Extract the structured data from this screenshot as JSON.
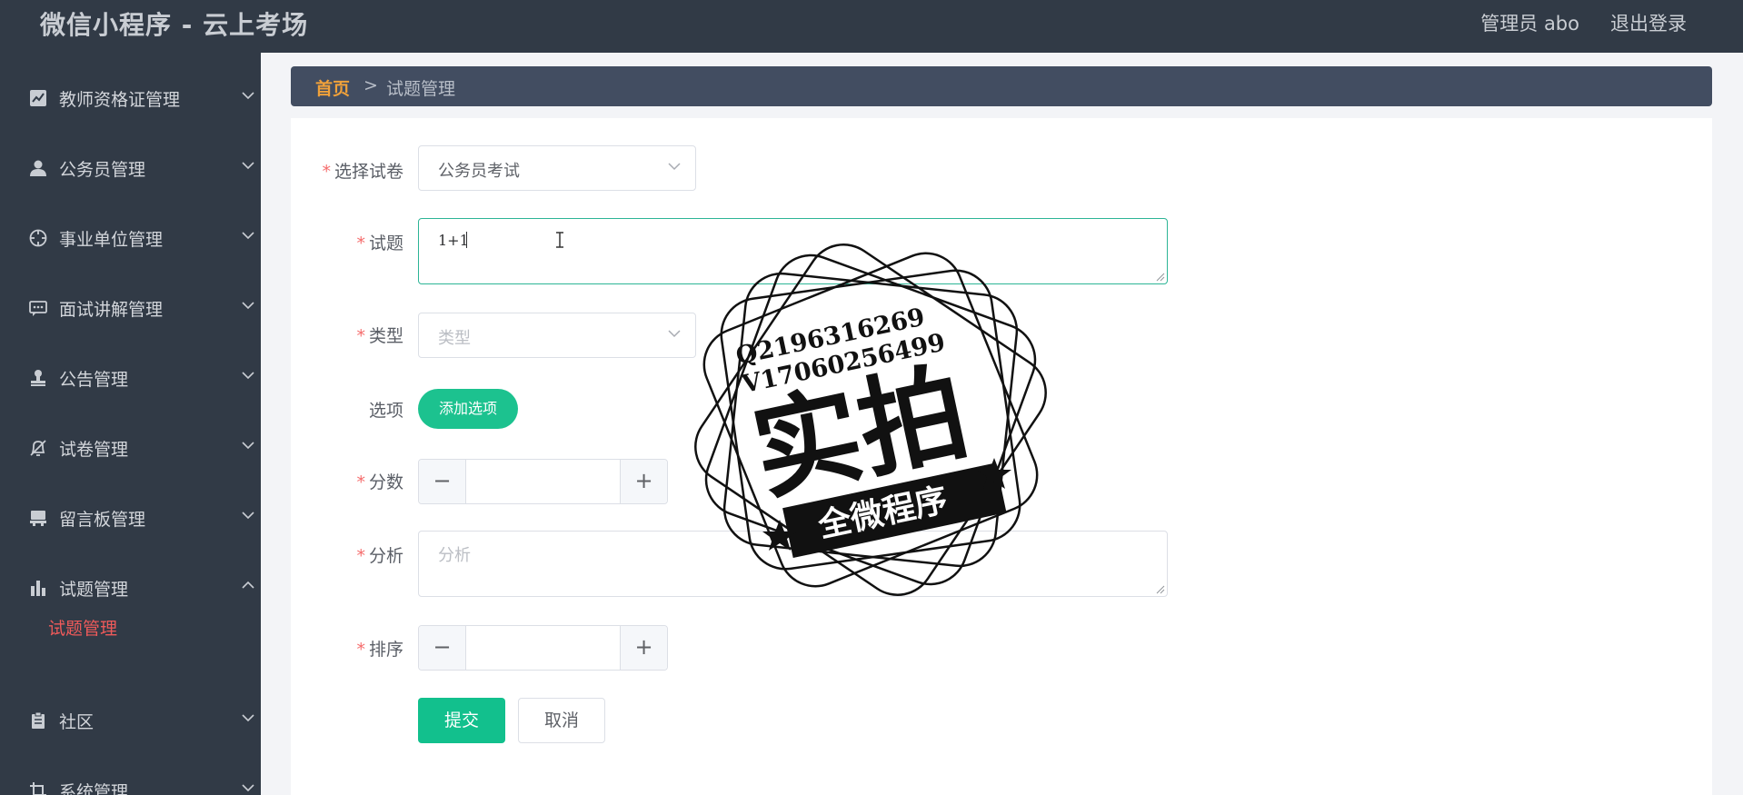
{
  "app": {
    "title": "微信小程序 - 云上考场"
  },
  "header": {
    "user_label": "管理员 abo",
    "logout_label": "退出登录"
  },
  "sidebar": {
    "items": [
      {
        "label": "教师资格证管理",
        "icon": "chart-icon"
      },
      {
        "label": "公务员管理",
        "icon": "user-icon"
      },
      {
        "label": "事业单位管理",
        "icon": "compass-icon"
      },
      {
        "label": "面试讲解管理",
        "icon": "chat-icon"
      },
      {
        "label": "公告管理",
        "icon": "stamp-icon"
      },
      {
        "label": "试卷管理",
        "icon": "bell-off-icon"
      },
      {
        "label": "留言板管理",
        "icon": "message-board-icon"
      },
      {
        "label": "试题管理",
        "icon": "bar-chart-icon",
        "expanded": true
      },
      {
        "label": "社区",
        "icon": "clipboard-icon"
      },
      {
        "label": "系统管理",
        "icon": "crop-icon"
      }
    ],
    "sub_item": "试题管理",
    "active_color": "#ee5a5a"
  },
  "breadcrumb": {
    "home": "首页",
    "separator": ">",
    "current": "试题管理"
  },
  "form": {
    "paper": {
      "label": "选择试卷",
      "value": "公务员考试"
    },
    "question": {
      "label": "试题",
      "value": "1+1"
    },
    "type": {
      "label": "类型",
      "placeholder": "类型"
    },
    "options": {
      "label": "选项",
      "button": "添加选项"
    },
    "score": {
      "label": "分数",
      "dec": "−",
      "inc": "+",
      "value": ""
    },
    "analysis": {
      "label": "分析",
      "placeholder": "分析"
    },
    "order": {
      "label": "排序",
      "dec": "−",
      "inc": "+",
      "value": ""
    },
    "submit": "提交",
    "cancel": "取消"
  },
  "watermark": {
    "line1": "Q2196316269",
    "line2": "V17060256499",
    "big": "实拍",
    "banner": "全微程序"
  },
  "colors": {
    "sidebar_bg": "#313a46",
    "primary": "#1cc28f",
    "breadcrumb_home": "#f0a13a",
    "required": "#f56c6c"
  }
}
